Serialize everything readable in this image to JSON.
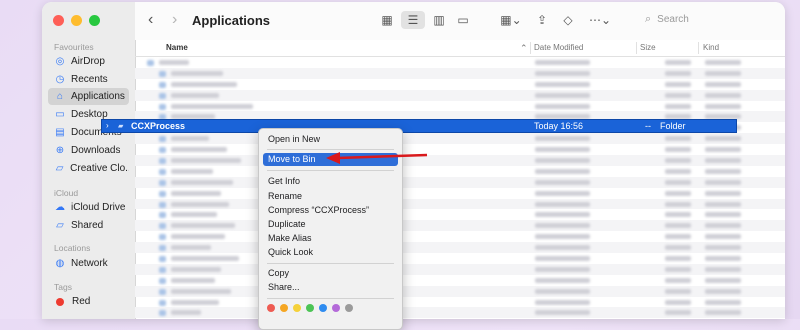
{
  "window": {
    "title": "Applications"
  },
  "sidebar": {
    "favourites_heading": "Favourites",
    "favourites": [
      {
        "label": "AirDrop",
        "icon": "airdrop-icon"
      },
      {
        "label": "Recents",
        "icon": "clock-icon"
      },
      {
        "label": "Applications",
        "icon": "applications-icon",
        "active": true
      },
      {
        "label": "Desktop",
        "icon": "desktop-icon"
      },
      {
        "label": "Documents",
        "icon": "document-icon"
      },
      {
        "label": "Downloads",
        "icon": "download-icon"
      },
      {
        "label": "Creative Clo...",
        "icon": "folder-icon"
      }
    ],
    "icloud_heading": "iCloud",
    "icloud": [
      {
        "label": "iCloud Drive",
        "icon": "cloud-icon"
      },
      {
        "label": "Shared",
        "icon": "shared-folder-icon"
      }
    ],
    "locations_heading": "Locations",
    "locations": [
      {
        "label": "Network",
        "icon": "globe-icon"
      }
    ],
    "tags_heading": "Tags",
    "tags": [
      {
        "label": "Red",
        "color": "#ee3b30"
      }
    ]
  },
  "toolbar": {
    "back_icon": "chevron-left-icon",
    "forward_icon": "chevron-right-icon",
    "search_placeholder": "Search"
  },
  "columns": {
    "name": "Name",
    "date": "Date Modified",
    "size": "Size",
    "kind": "Kind"
  },
  "selected_row": {
    "name": "CCXProcess",
    "date": "Today 16:56",
    "size": "--",
    "kind": "Folder"
  },
  "context_menu": {
    "items": [
      "Open in New",
      "Move to Bin",
      "Get Info",
      "Rename",
      "Compress “CCXProcess”",
      "Duplicate",
      "Make Alias",
      "Quick Look",
      "Copy",
      "Share..."
    ],
    "highlighted": "Move to Bin",
    "tag_colors": [
      "#ee5b52",
      "#f5a623",
      "#f5d13a",
      "#4cc455",
      "#2f8cf0",
      "#b46ad9",
      "#9b9b9b"
    ]
  },
  "colors": {
    "accent": "#2f6ed8",
    "annotation_arrow": "#d9191c"
  }
}
